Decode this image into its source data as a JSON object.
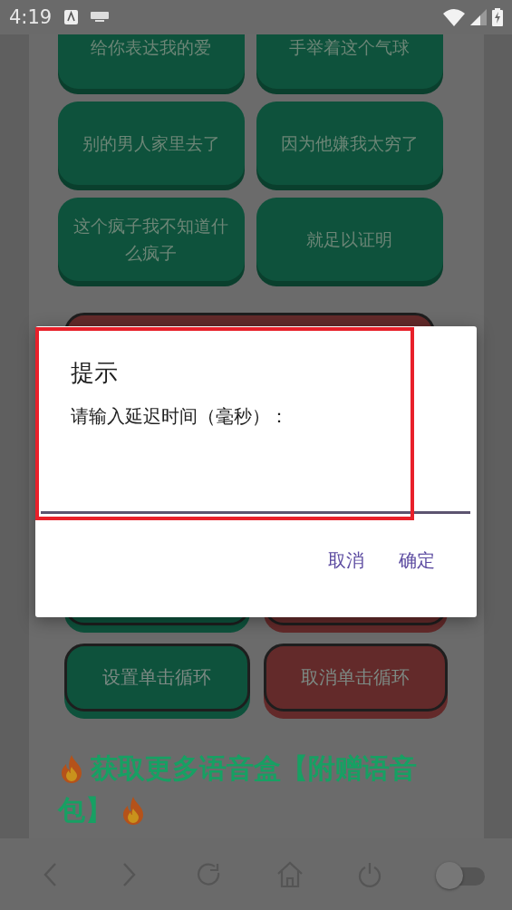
{
  "status_bar": {
    "time": "4:19"
  },
  "voice_buttons": [
    {
      "label": "给你表达我的爱"
    },
    {
      "label": "手举着这个气球"
    },
    {
      "label": "别的男人家里去了"
    },
    {
      "label": "因为他嫌我太穷了"
    },
    {
      "label": "这个疯子我不知道什么疯子"
    },
    {
      "label": "就足以证明"
    }
  ],
  "hidden_buttons": [
    {
      "kind": "wide",
      "color": "#632a2a"
    },
    {
      "kind": "half",
      "color": "#0e523c"
    },
    {
      "kind": "half",
      "color": "#632a2a"
    }
  ],
  "loop_buttons": [
    {
      "label": "设置单击循环",
      "color": "#0e523c"
    },
    {
      "label": "取消单击循环",
      "color": "#632a2a"
    }
  ],
  "promo_heading": "获取更多语音盒【附赠语音包】",
  "dialog": {
    "title": "提示",
    "message": "请输入延迟时间（毫秒）：",
    "highlighted": true,
    "buttons": [
      "取消",
      "确定"
    ]
  },
  "nav_bar": {
    "toggle_on": false
  }
}
